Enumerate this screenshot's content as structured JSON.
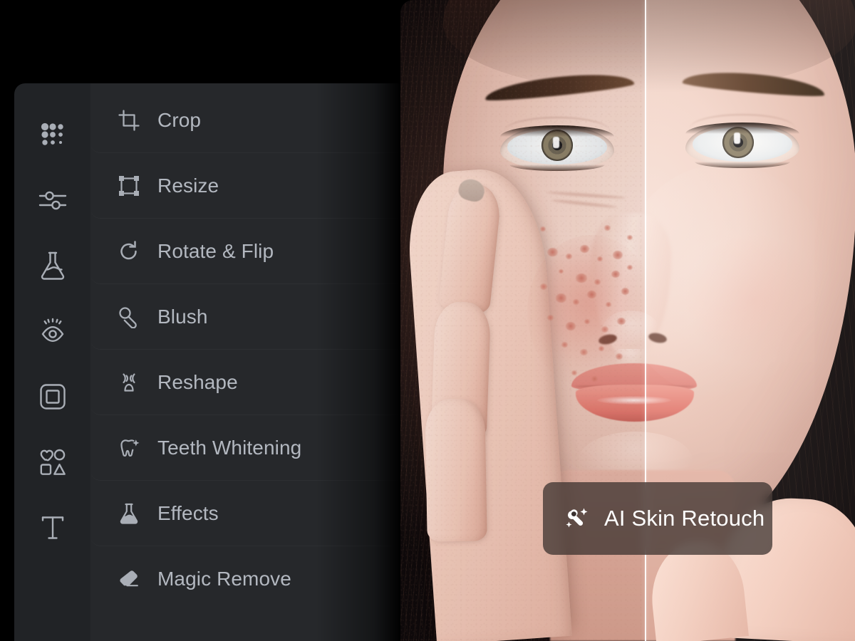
{
  "app": {
    "background_color": "#000000",
    "sidebar_rail_color": "#212326",
    "sidebar_panel_color": "#26282b",
    "menu_label_color": "#b3b8c0",
    "badge_color": "#342c2a",
    "divider_color": "#ffffff"
  },
  "rail": {
    "items": [
      {
        "name": "dots-grid-icon",
        "label": "Basic Tools"
      },
      {
        "name": "sliders-icon",
        "label": "Adjust"
      },
      {
        "name": "flask-icon",
        "label": "Effects"
      },
      {
        "name": "eye-retouch-icon",
        "label": "Retouch"
      },
      {
        "name": "frame-icon",
        "label": "Frames"
      },
      {
        "name": "shapes-icon",
        "label": "Elements"
      },
      {
        "name": "text-icon",
        "label": "Text"
      }
    ]
  },
  "menu": {
    "items": [
      {
        "label": "Crop",
        "icon": "crop-icon"
      },
      {
        "label": "Resize",
        "icon": "resize-icon"
      },
      {
        "label": "Rotate & Flip",
        "icon": "rotate-icon"
      },
      {
        "label": "Blush",
        "icon": "blush-icon"
      },
      {
        "label": "Reshape",
        "icon": "reshape-icon"
      },
      {
        "label": "Teeth Whitening",
        "icon": "tooth-sparkle-icon"
      },
      {
        "label": "Effects",
        "icon": "flask-icon"
      },
      {
        "label": "Magic Remove",
        "icon": "eraser-icon"
      }
    ]
  },
  "canvas": {
    "badge": {
      "label": "AI Skin Retouch",
      "icon": "magic-wand-sparkle-icon"
    },
    "comparison": {
      "divider_label": "before-after-split",
      "before_side": "left",
      "after_side": "right"
    }
  }
}
